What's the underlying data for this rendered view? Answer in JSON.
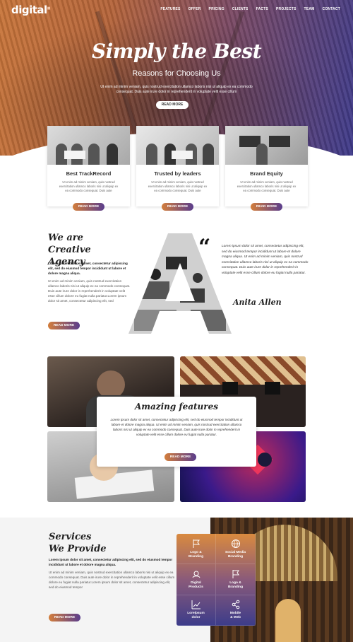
{
  "brand": {
    "logo": "digital"
  },
  "nav": [
    "FEATURES",
    "OFFER",
    "PRICING",
    "CLIENTS",
    "FACTS",
    "PROJECTS",
    "TEAM",
    "CONTACT"
  ],
  "hero": {
    "title": "Simply the Best",
    "subtitle": "Reasons for Choosing Us",
    "body": "Ut enim ad minim veniam, quis nostrud exercitation ullamco laboris nisi ut aliquip ex ea commodo consequat. Duis aute irure dolor in reprehenderit in voluptate velit esse cillum",
    "button": "READ MORE"
  },
  "cards": [
    {
      "title": "Best TrackRecord",
      "body": "Ut enim ad minim veniam, quis nostrud exercitation ullamco laboris nisi ut aliquip ex ea commodo consequat. Duis aute",
      "button": "READ MORE"
    },
    {
      "title": "Trusted by leaders",
      "body": "Ut enim ad minim veniam, quis nostrud exercitation ullamco laboris nisi ut aliquip ex ea commodo consequat. Duis aute",
      "button": "READ MORE"
    },
    {
      "title": "Brand Equity",
      "body": "Ut enim ad minim veniam, quis nostrud exercitation ullamco laboris nisi ut aliquip ex ea commodo consequat. Duis aute",
      "button": "READ MORE"
    }
  ],
  "creative": {
    "title_line1": "We are",
    "title_line2": "Creative Agency",
    "lead": "Lorem ipsum dolor sit amet, consectetur adipiscing elit, sed do eiusmod tempor incididunt ut labore et dolore magna aliqua.",
    "body": "Ut enim ad minim veniam, quis nostrud exercitation ullamco laboris nisi ut aliquip ex ea commodo consequat. Duis aute irure dolor in reprehenderit in voluptate velit esse cillum dolore eu fugiat nulla pariatur.Lorem ipsum dolor sit amet, consectetur adipiscing elit, sed",
    "button": "READ MORE",
    "quote_mark": "“",
    "quote": "Lorem ipsum dolor sit amet, consectetur adipiscing elit, sed do eiusmod tempor incididunt ut labore et dolore magna aliqua. Ut enim ad minim veniam, quis nostrud exercitation ullamco laboris nisi ut aliquip ex ea commodo consequat. Duis aute irure dolor in reprehenderit in voluptate velit esse cillum dolore eu fugiat nulla pariatur.",
    "author": "Anita Allen"
  },
  "features": {
    "title": "Amazing features",
    "body": "Lorem ipsum dolor sit amet, consectetur adipiscing elit, sed do eiusmod tempor incididunt ut labore et dolore magna aliqua. Ut enim ad minim veniam, quis nostrud exercitation ullamco laboris nisi ut aliquip ex ea commodo consequat. Duis aute irure dolor in reprehenderit in voluptate velit esse cillum dolore eu fugiat nulla pariatur.",
    "button": "READ MORE"
  },
  "services": {
    "title_line1": "Services",
    "title_line2": "We Provide",
    "lead": "Lorem ipsum dolor sit amet, consectetur adipiscing elit, sed do eiusmod tempor incididunt ut labore et dolore magna aliqua.",
    "body": "Ut enim ad minim veniam, quis nostrud exercitation ullamco laboris nisi ut aliquip ex ea commodo consequat. Duis aute irure dolor in reprehenderit in voluptate velit esse cillum dolore eu fugiat nulla pariatur.Lorem ipsum dolor sit amet, consectetur adipiscing elit, sed do eiusmod tempor",
    "button": "READ MORE",
    "items": [
      {
        "line1": "Logo &",
        "line2": "Branding",
        "icon": "flag-icon"
      },
      {
        "line1": "Social Media",
        "line2": "Branding",
        "icon": "globe-icon"
      },
      {
        "line1": "Digital",
        "line2": "Products",
        "icon": "headset-icon"
      },
      {
        "line1": "Logo &",
        "line2": "Branding",
        "icon": "flag-icon"
      },
      {
        "line1": "Lorelpsum",
        "line2": "dolor",
        "icon": "chart-icon"
      },
      {
        "line1": "Mobile",
        "line2": "& Web",
        "icon": "share-icon"
      }
    ]
  },
  "colors": {
    "accent_orange": "#d37e3c",
    "accent_purple": "#5a3d8c"
  }
}
